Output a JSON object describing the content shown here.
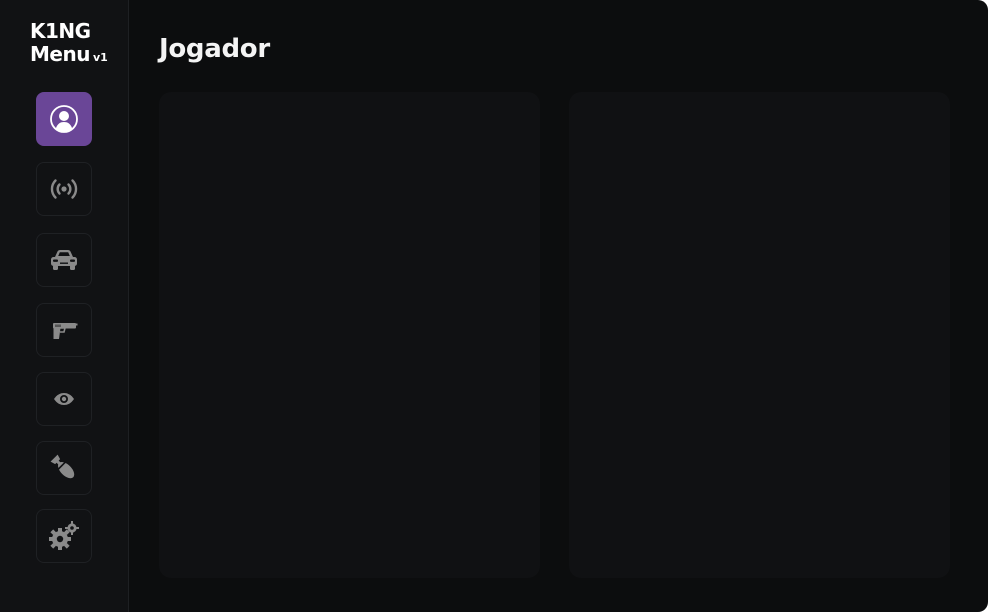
{
  "logo": {
    "line1": "K1NG",
    "line2": "Menu",
    "version": "v1"
  },
  "page": {
    "title": "Jogador"
  },
  "sidebar": {
    "items": [
      {
        "id": "player",
        "icon": "user-icon",
        "active": true
      },
      {
        "id": "network",
        "icon": "broadcast-icon",
        "active": false
      },
      {
        "id": "vehicle",
        "icon": "car-icon",
        "active": false
      },
      {
        "id": "weapon",
        "icon": "pistol-icon",
        "active": false
      },
      {
        "id": "visual",
        "icon": "eye-icon",
        "active": false
      },
      {
        "id": "destruction",
        "icon": "bomb-icon",
        "active": false
      },
      {
        "id": "settings",
        "icon": "gears-icon",
        "active": false
      }
    ]
  },
  "colors": {
    "accent": "#6a4697",
    "background": "#0c0d0e",
    "sidebar": "#111214",
    "panel": "#101113",
    "icon": "#8a8a8a",
    "text": "#f4f4f4"
  }
}
